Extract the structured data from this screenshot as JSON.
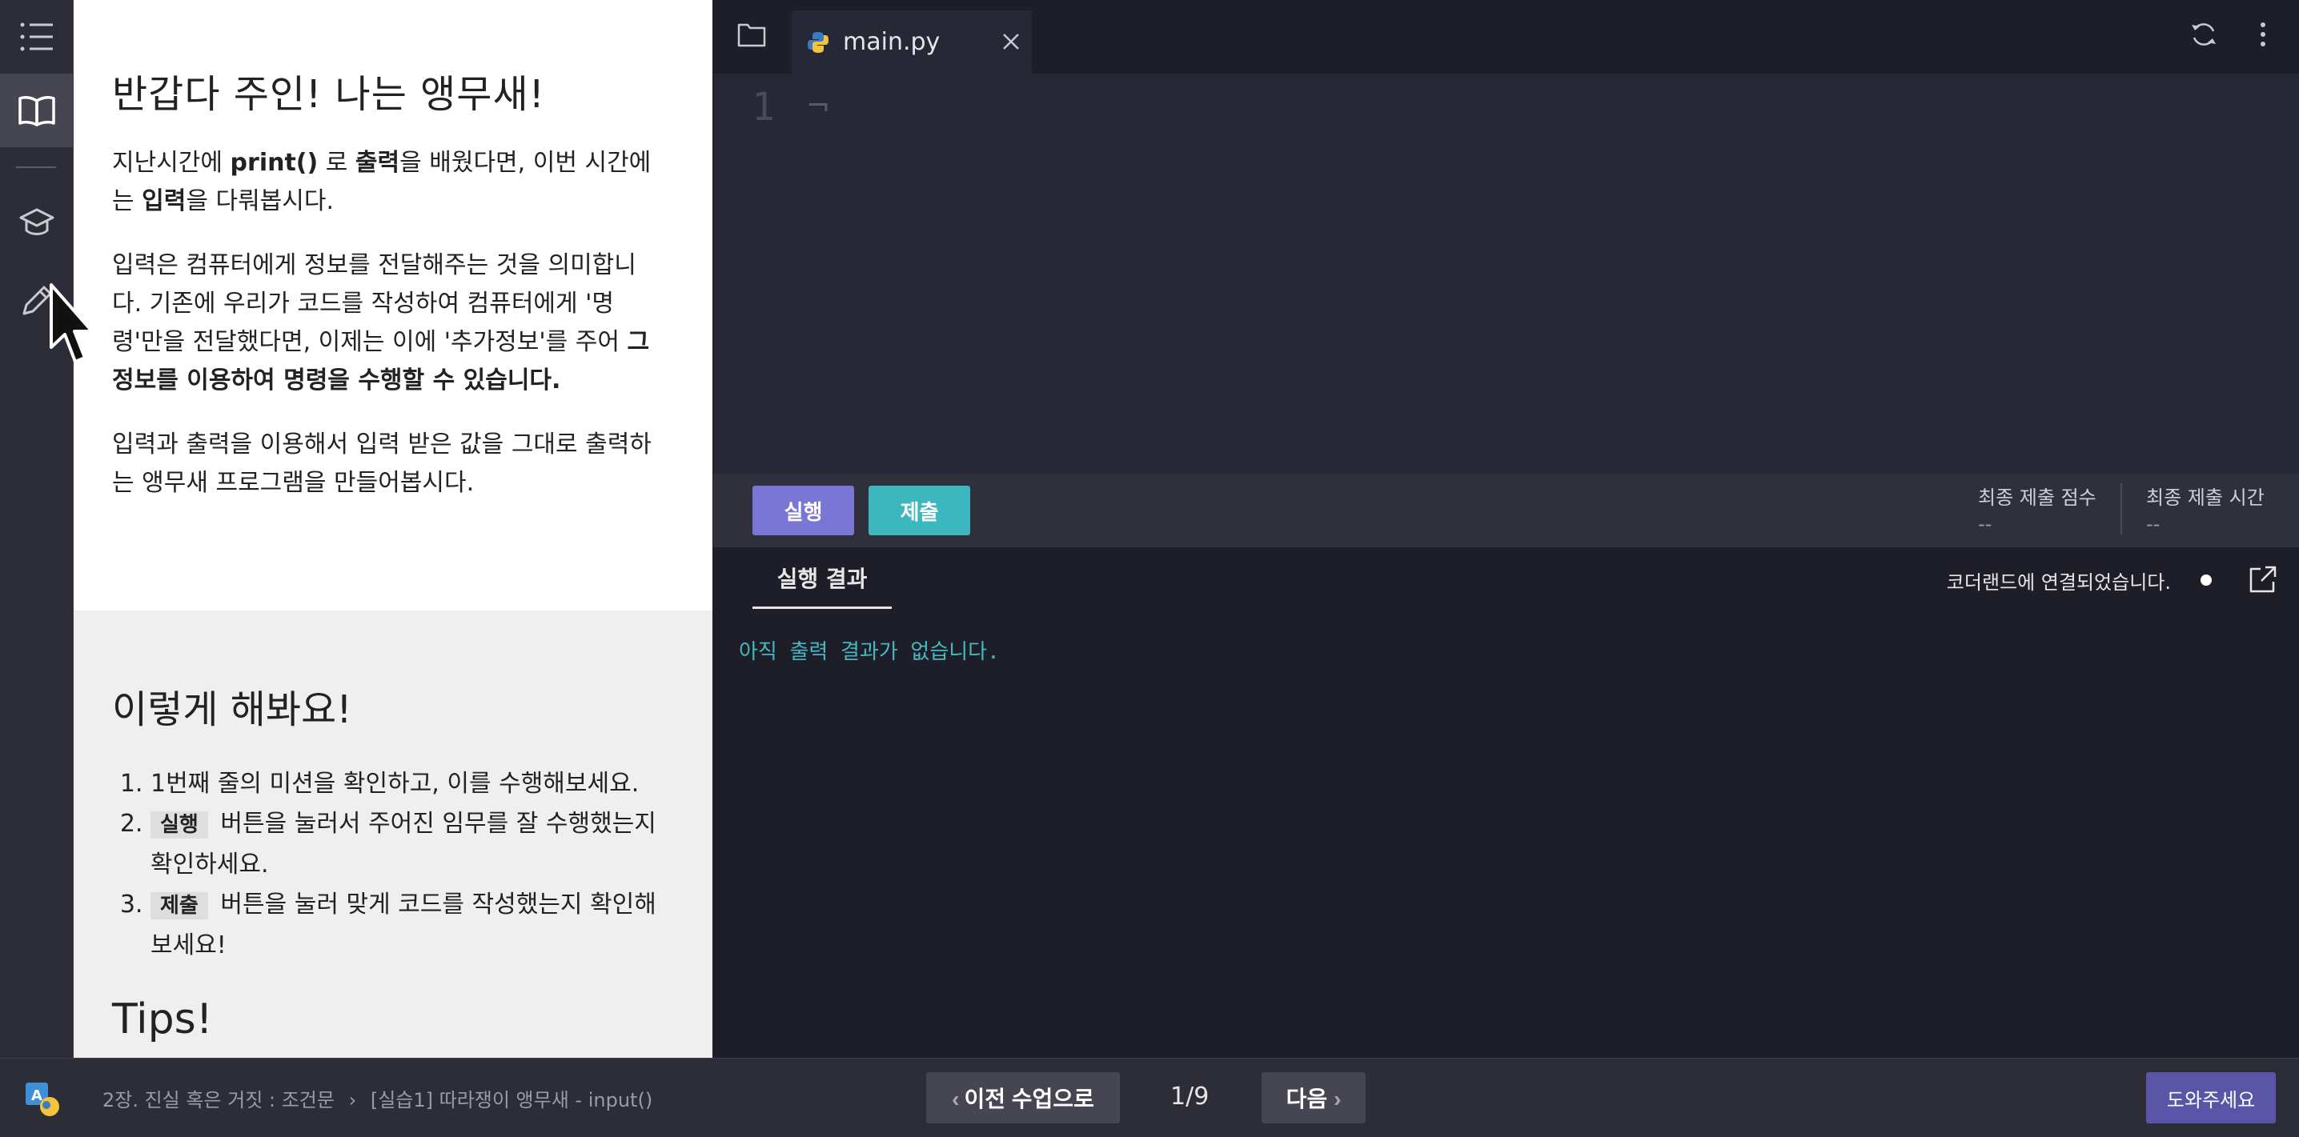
{
  "sidebar": {
    "items": [
      {
        "icon": "list-icon"
      },
      {
        "icon": "book-icon",
        "active": true
      },
      {
        "icon": "graduation-cap-icon"
      },
      {
        "icon": "pencil-icon"
      }
    ]
  },
  "lesson": {
    "title": "반갑다 주인! 나는 앵무새!",
    "p1_a": "지난시간에 ",
    "p1_b": "print()",
    "p1_c": " 로 ",
    "p1_d": "출력",
    "p1_e": "을 배웠다면, 이번 시간에는 ",
    "p1_f": "입력",
    "p1_g": "을 다뤄봅시다.",
    "p2_a": "입력은 컴퓨터에게 정보를 전달해주는 것을 의미합니다. 기존에 우리가 코드를 작성하여 컴퓨터에게 '명령'만을 전달했다면, 이제는 이에 '추가정보'를 주어 ",
    "p2_b": "그 정보를 이용하여 명령을 수행할 수 있습니다.",
    "p3": "입력과 출력을 이용해서 입력 받은 값을 그대로 출력하는 앵무새 프로그램을 만들어봅시다.",
    "section_title": "이렇게 해봐요!",
    "steps": {
      "s1": "1번째 줄의 미션을 확인하고, 이를 수행해보세요.",
      "s2_kbd": "실행",
      "s2": "버튼을 눌러서 주어진 임무를 잘 수행했는지 확인하세요.",
      "s3_kbd": "제출",
      "s3": "버튼을 눌러 맞게 코드를 작성했는지 확인해보세요!"
    },
    "tips": "Tips!"
  },
  "editor": {
    "tab_name": "main.py",
    "line_number": "1",
    "code": "¬"
  },
  "actions": {
    "run": "실행",
    "submit": "제출",
    "score_label": "최종 제출 점수",
    "score_value": "--",
    "time_label": "최종 제출 시간",
    "time_value": "--"
  },
  "output": {
    "tab": "실행 결과",
    "connection": "코더랜드에 연결되었습니다.",
    "message": "아직 출력 결과가 없습니다."
  },
  "footer": {
    "chapter": "2장. 진실 혹은 거짓 : 조건문",
    "separator": "›",
    "lesson": "[실습1] 따라쟁이 앵무새 - input()",
    "prev": "이전 수업으로",
    "page": "1/9",
    "next": "다음",
    "help": "도와주세요"
  },
  "colors": {
    "run_button": "#7a76d6",
    "submit_button": "#3cb6bf",
    "help_button": "#5b55a8",
    "output_text": "#45b8c2"
  }
}
